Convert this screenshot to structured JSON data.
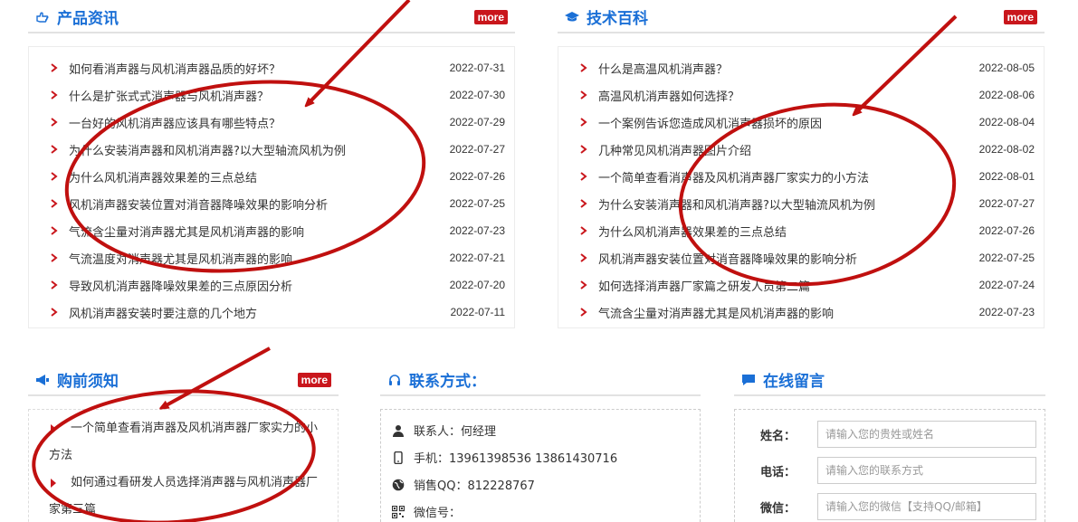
{
  "product_news": {
    "title": "产品资讯",
    "more": "more",
    "items": [
      {
        "title": "如何看消声器与风机消声器品质的好坏？",
        "date": "2022-07-31"
      },
      {
        "title": "什么是扩张式式消声器与风机消声器？",
        "date": "2022-07-30"
      },
      {
        "title": "一台好的风机消声器应该具有哪些特点？",
        "date": "2022-07-29"
      },
      {
        "title": "为什么安装消声器和风机消声器?以大型轴流风机为例",
        "date": "2022-07-27"
      },
      {
        "title": "为什么风机消声器效果差的三点总结",
        "date": "2022-07-26"
      },
      {
        "title": "风机消声器安装位置对消音器降噪效果的影响分析",
        "date": "2022-07-25"
      },
      {
        "title": "气流含尘量对消声器尤其是风机消声器的影响",
        "date": "2022-07-23"
      },
      {
        "title": "气流温度对消声器尤其是风机消声器的影响",
        "date": "2022-07-21"
      },
      {
        "title": "导致风机消声器降噪效果差的三点原因分析",
        "date": "2022-07-20"
      },
      {
        "title": "风机消声器安装时要注意的几个地方",
        "date": "2022-07-11"
      }
    ]
  },
  "tech_wiki": {
    "title": "技术百科",
    "more": "more",
    "items": [
      {
        "title": "什么是高温风机消声器？",
        "date": "2022-08-05"
      },
      {
        "title": "高温风机消声器如何选择？",
        "date": "2022-08-06"
      },
      {
        "title": "一个案例告诉您造成风机消声器损坏的原因",
        "date": "2022-08-04"
      },
      {
        "title": "几种常见风机消声器图片介绍",
        "date": "2022-08-02"
      },
      {
        "title": "一个简单查看消声器及风机消声器厂家实力的小方法",
        "date": "2022-08-01"
      },
      {
        "title": "为什么安装消声器和风机消声器?以大型轴流风机为例",
        "date": "2022-07-27"
      },
      {
        "title": "为什么风机消声器效果差的三点总结",
        "date": "2022-07-26"
      },
      {
        "title": "风机消声器安装位置对消音器降噪效果的影响分析",
        "date": "2022-07-25"
      },
      {
        "title": "如何选择消声器厂家篇之研发人员第二篇",
        "date": "2022-07-24"
      },
      {
        "title": "气流含尘量对消声器尤其是风机消声器的影响",
        "date": "2022-07-23"
      }
    ]
  },
  "purchase_notice": {
    "title": "购前须知",
    "more": "more",
    "items": [
      "一个简单查看消声器及风机消声器厂家实力的小方法",
      "如何通过看研发人员选择消声器与风机消声器厂家第三篇"
    ]
  },
  "contact": {
    "title": "联系方式：",
    "person": "联系人：何经理",
    "phone": "手机：13961398536 13861430716",
    "qq": "销售QQ：812228767",
    "wechat": "微信号："
  },
  "message": {
    "title": "在线留言",
    "name_label": "姓名：",
    "name_placeholder": "请输入您的贵姓或姓名",
    "phone_label": "电话：",
    "phone_placeholder": "请输入您的联系方式",
    "wechat_label": "微信：",
    "wechat_placeholder": "请输入您的微信【支持QQ/邮箱】"
  },
  "colors": {
    "title_blue": "#1a6fd6",
    "accent_red": "#c9161c",
    "annotation_red": "#c0100f"
  }
}
